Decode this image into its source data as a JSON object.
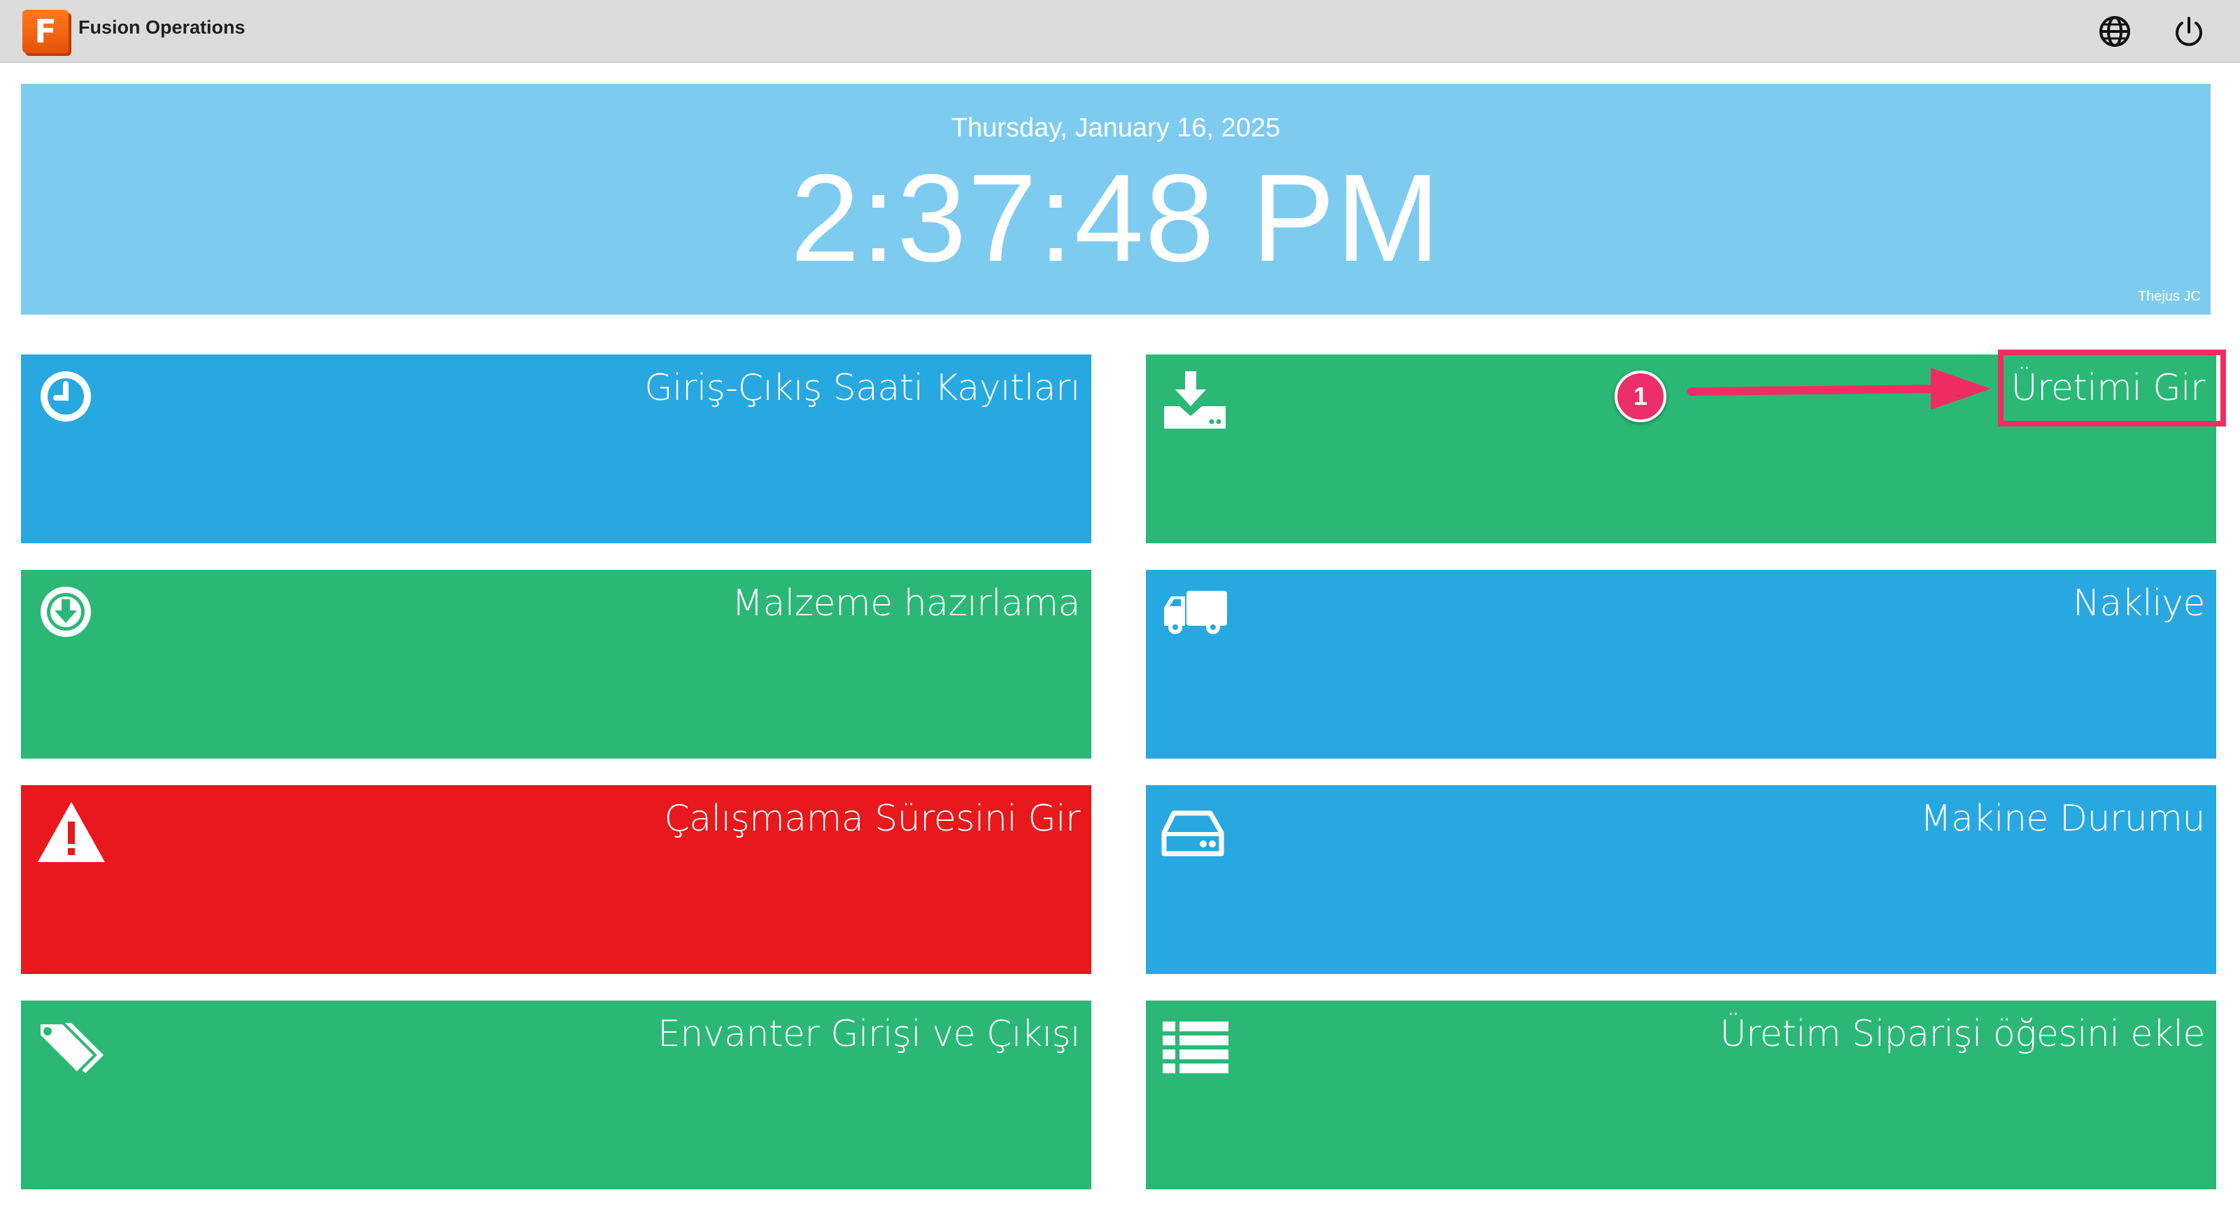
{
  "app": {
    "logo_letter": "F",
    "title": "Fusion Operations"
  },
  "header_icons": [
    "globe-icon",
    "power-icon"
  ],
  "clock": {
    "date": "Thursday, January 16, 2025",
    "time": "2:37:48 PM",
    "user": "Thejus JC"
  },
  "tiles": [
    {
      "label": "Giriş-Çıkış Saati Kayıtları",
      "icon": "clock-icon",
      "color": "#28a8e1"
    },
    {
      "label": "Üretimi Gir",
      "icon": "download-tray-icon",
      "color": "#2bb876"
    },
    {
      "label": "Malzeme hazırlama",
      "icon": "arrow-down-circle-icon",
      "color": "#2bb876"
    },
    {
      "label": "Nakliye",
      "icon": "truck-icon",
      "color": "#28a8e1"
    },
    {
      "label": "Çalışmama Süresini Gir",
      "icon": "warning-icon",
      "color": "#e8181c"
    },
    {
      "label": "Makine Durumu",
      "icon": "hard-drive-icon",
      "color": "#28a8e1"
    },
    {
      "label": "Envanter Girişi ve Çıkışı",
      "icon": "tags-icon",
      "color": "#2bb876"
    },
    {
      "label": "Üretim Siparişi öğesini ekle",
      "icon": "list-icon",
      "color": "#2bb876"
    }
  ],
  "annotation": {
    "step_number": "1",
    "highlight_color": "#ee2e62"
  }
}
